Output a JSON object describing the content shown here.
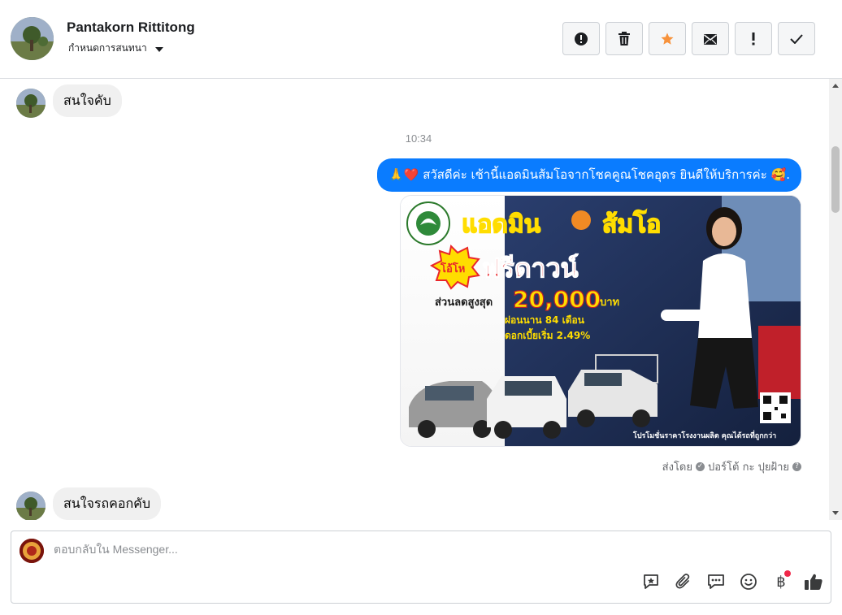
{
  "header": {
    "contact_name": "Pantakorn Rittitong",
    "assign_label": "กำหนดการสนทนา",
    "toolbar": [
      {
        "icon": "alert-circle-icon"
      },
      {
        "icon": "trash-icon"
      },
      {
        "icon": "star-icon",
        "color": "#f7923b"
      },
      {
        "icon": "mark-unread-icon"
      },
      {
        "icon": "exclamation-icon"
      },
      {
        "icon": "checkmark-icon"
      }
    ]
  },
  "conversation": {
    "messages": [
      {
        "direction": "in",
        "text": "สนใจคับ"
      },
      {
        "type": "timestamp",
        "text": "10:34"
      },
      {
        "direction": "out",
        "emoji": "🙏❤️",
        "text": "สวัสดีค่ะ เช้านี้แอดมินส้มโอจากโชคคูณโชคอุดร ยินดีให้บริการค่ะ",
        "emoji_end": "🥰."
      },
      {
        "direction": "out",
        "type": "image",
        "image_text": {
          "title_left": "แอดมิน",
          "title_right": "ส้มโอ",
          "badge": "โอ้โห",
          "headline": "ฟรีดาวน์",
          "discount_label": "ส่วนลดสูงสุด",
          "discount_value": "20,000",
          "discount_unit": "บาท",
          "installment": "ผ่อนนาน 84 เดือน",
          "interest": "ดอกเบี้ยเริ่ม 2.49%",
          "footer": "โปรโมชั่นราคาโรงงานผลิต คุณได้รถที่ถูกกว่า"
        }
      },
      {
        "type": "sent_by",
        "prefix": "ส่งโดย",
        "name": "ปอร์โต้ กะ ปุยฝ้าย"
      },
      {
        "direction": "in",
        "text": "สนใจรถคอกคับ"
      }
    ]
  },
  "composer": {
    "placeholder": "ตอบกลับใน Messenger...",
    "baht_symbol": "฿",
    "tools": [
      "saved-reply-icon",
      "attachment-icon",
      "quick-reply-icon",
      "emoji-icon",
      "payment-icon",
      "like-icon"
    ]
  },
  "colors": {
    "accent": "#0a7cff",
    "bubble_in": "#f0f0f0",
    "star": "#f7923b"
  }
}
